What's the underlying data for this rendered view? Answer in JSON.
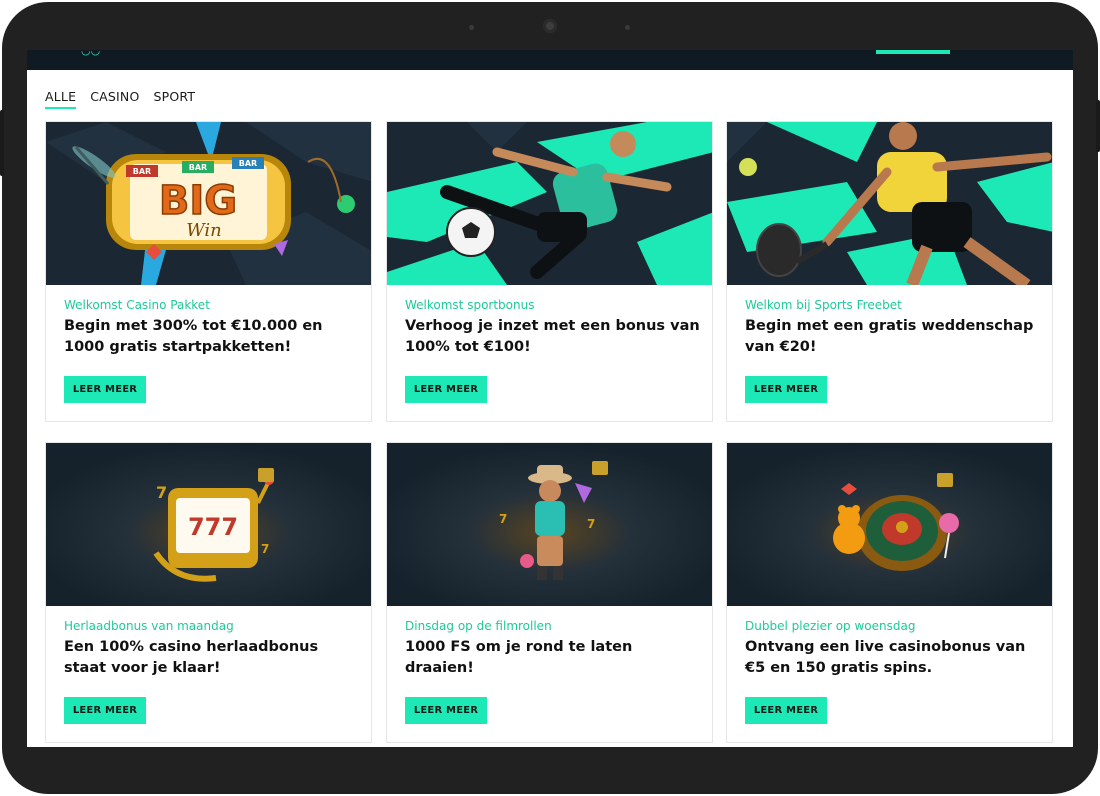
{
  "tabs": [
    {
      "label": "ALLE",
      "active": true
    },
    {
      "label": "CASINO",
      "active": false
    },
    {
      "label": "SPORT",
      "active": false
    }
  ],
  "cards": [
    {
      "subtitle": "Welkomst Casino Pakket",
      "title": "Begin met 300% tot €10.000 en 1000 gratis startpakketten!",
      "button": "LEER MEER",
      "image": "big-win-slot-image",
      "big_win_text": "BIG",
      "big_win_script": "Win",
      "reel_labels": [
        "BAR",
        "BAR",
        "BAR"
      ]
    },
    {
      "subtitle": "Welkomst sportbonus",
      "title": "Verhoog je inzet met een bonus van 100% tot €100!",
      "button": "LEER MEER",
      "image": "soccer-player-image"
    },
    {
      "subtitle": "Welkom bij Sports Freebet",
      "title": "Begin met een gratis weddenschap van €20!",
      "button": "LEER MEER",
      "image": "padel-player-image"
    },
    {
      "subtitle": "Herlaadbonus van maandag",
      "title": "Een 100% casino herlaadbonus staat voor je klaar!",
      "button": "LEER MEER",
      "image": "slot-machine-777-image",
      "reel_text": "777"
    },
    {
      "subtitle": "Dinsdag op de filmrollen",
      "title": "1000 FS om je rond te laten draaien!",
      "button": "LEER MEER",
      "image": "cowboy-character-image"
    },
    {
      "subtitle": "Dubbel plezier op woensdag",
      "title": "Ontvang een live casinobonus van €5 en 150 gratis spins.",
      "button": "LEER MEER",
      "image": "roulette-bear-image"
    }
  ],
  "colors": {
    "accent": "#1de9b6",
    "subtitle": "#1ec99a",
    "banner_dark": "#15212b",
    "frame": "#212121"
  }
}
